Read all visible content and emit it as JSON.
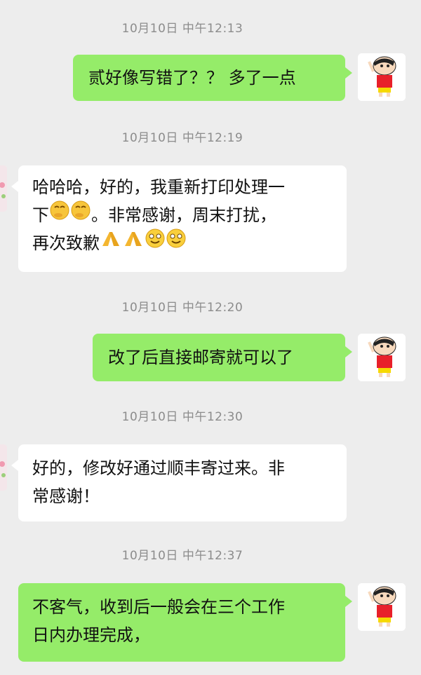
{
  "conversation": {
    "timestamps": [
      "10月10日 中午12:13",
      "10月10日 中午12:19",
      "10月10日 中午12:20",
      "10月10日 中午12:30",
      "10月10日 中午12:37"
    ],
    "messages": [
      {
        "sender": "self",
        "text": "贰好像写错了？？ 多了一点"
      },
      {
        "sender": "other",
        "line1": "哈哈哈，好的，我重新打印处理一",
        "line2_prefix": "下",
        "line2_suffix": "。非常感谢，周末打扰，",
        "line3_prefix": "再次致歉",
        "emojis": [
          "thinking-emoji",
          "thinking-emoji",
          "pray-emoji",
          "pray-emoji",
          "smile-emoji",
          "smile-emoji"
        ]
      },
      {
        "sender": "self",
        "text": "改了后直接邮寄就可以了"
      },
      {
        "sender": "other",
        "line1": "好的，修改好通过顺丰寄过来。非",
        "line2": "常感谢！"
      },
      {
        "sender": "self",
        "line1": "不客气，收到后一般会在三个工作",
        "line2": "日内办理完成，"
      }
    ]
  },
  "colors": {
    "background": "#ededed",
    "outgoing_bubble": "#95ec69",
    "incoming_bubble": "#ffffff",
    "timestamp_text": "#8c8c8c"
  }
}
